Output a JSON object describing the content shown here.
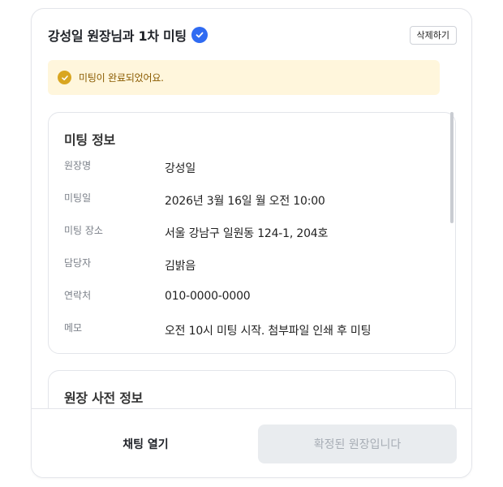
{
  "header": {
    "title": "강성일 원장님과 1차 미팅",
    "delete_label": "삭제하기"
  },
  "notice": {
    "text": "미팅이 완료되었어요."
  },
  "meeting_info": {
    "title": "미팅 정보",
    "rows": [
      {
        "label": "원장명",
        "value": "강성일"
      },
      {
        "label": "미팅일",
        "value": "2026년 3월 16일 월 오전 10:00"
      },
      {
        "label": "미팅 장소",
        "value": "서울 강남구 일원동 124-1, 204호"
      },
      {
        "label": "담당자",
        "value": "김밝음"
      },
      {
        "label": "연락처",
        "value": "010-0000-0000"
      },
      {
        "label": "메모",
        "value": "오전 10시 미팅 시작. 첨부파일 인쇄 후 미팅"
      }
    ]
  },
  "pre_info": {
    "title": "원장 사전 정보"
  },
  "footer": {
    "chat_label": "채팅 열기",
    "confirm_label": "확정된 원장입니다"
  },
  "colors": {
    "accent": "#2f6bf2",
    "notice_bg": "#fff6dc",
    "notice_icon": "#d9a621",
    "disabled_bg": "#e9ecef"
  },
  "icons": {
    "verified": "check-circle-icon",
    "notice": "check-circle-icon"
  }
}
